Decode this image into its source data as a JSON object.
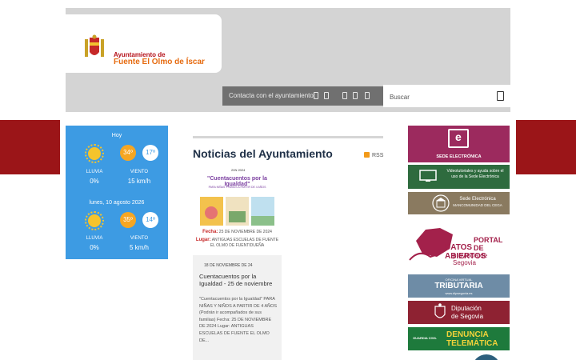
{
  "header": {
    "logo_line1": "Ayuntamiento de",
    "logo_line2": "Fuente El Olmo de Íscar",
    "contact_label": "Contacta con el ayuntamiento:",
    "search_placeholder": "Buscar"
  },
  "weather": {
    "days": [
      {
        "label": "Hoy",
        "high": "34º",
        "low": "17º",
        "rain_label": "LLUVIA",
        "rain_value": "0%",
        "wind_label": "VIENTO",
        "wind_value": "15 km/h"
      },
      {
        "label": "lunes, 10 agosto 2026",
        "high": "35º",
        "low": "14º",
        "rain_label": "LLUVIA",
        "rain_value": "0%",
        "wind_label": "VIENTO",
        "wind_value": "5 km/h"
      }
    ]
  },
  "news": {
    "section_title": "Noticias del Ayuntamiento",
    "rss_label": "RSS",
    "poster": {
      "year": "20N 2024",
      "title": "\"Cuentacuentos por la Igualdad\"",
      "subtitle": "PARA NIÑAS Y NIÑOS A PARTIR DE 4 AÑOS",
      "fecha_key": "Fecha:",
      "fecha_value": "25 DE NOVIEMBRE DE 2024",
      "lugar_key": "Lugar:",
      "lugar_value": "ANTIGUAS ESCUELAS DE FUENTE EL OLMO DE FUENTIDUEÑA"
    },
    "item": {
      "date": "18 DE NOVIEMBRE DE 24",
      "title": "Cuentacuentos por la Igualdad - 25 de noviembre",
      "excerpt": "\"Cuentacuentos por la Igualdad\" PARA NIÑAS Y NIÑOS A PARTIR DE 4 AÑOS (Podrán ir acompañados de sus familias) Fecha: 25 DE NOVIEMBRE DE 2024 Lugar: ANTIGUAS ESCUELAS DE FUENTE EL OLMO DE..."
    }
  },
  "banners": {
    "sede": "SEDE ELECTRÓNICA",
    "video": "Videotutoriales y ayuda sobre el uso de la Sede Electrónica",
    "mancom_line1": "Sede Electrónica",
    "mancom_line2": "MANCOMUNIDAD DEL CEGA",
    "datos_line1": "PORTAL DE",
    "datos_line2": "DATOS ABIERTOS",
    "datos_line3": "provincia de Segovia",
    "trib_small": "OFICINA VIRTUAL",
    "trib_big": "TRIBUTARIA",
    "trib_url": "www.dipsegovia.es",
    "dip_line1": "Diputación",
    "dip_line2": "de Segovia",
    "gc": "GUARDIA CIVIL",
    "denuncia_line1": "DENUNCIA",
    "denuncia_line2": "TELEMÁTICA"
  },
  "colors": {
    "brand_red": "#9b1518",
    "weather_blue": "#3d9be3",
    "title_navy": "#1f3047"
  }
}
